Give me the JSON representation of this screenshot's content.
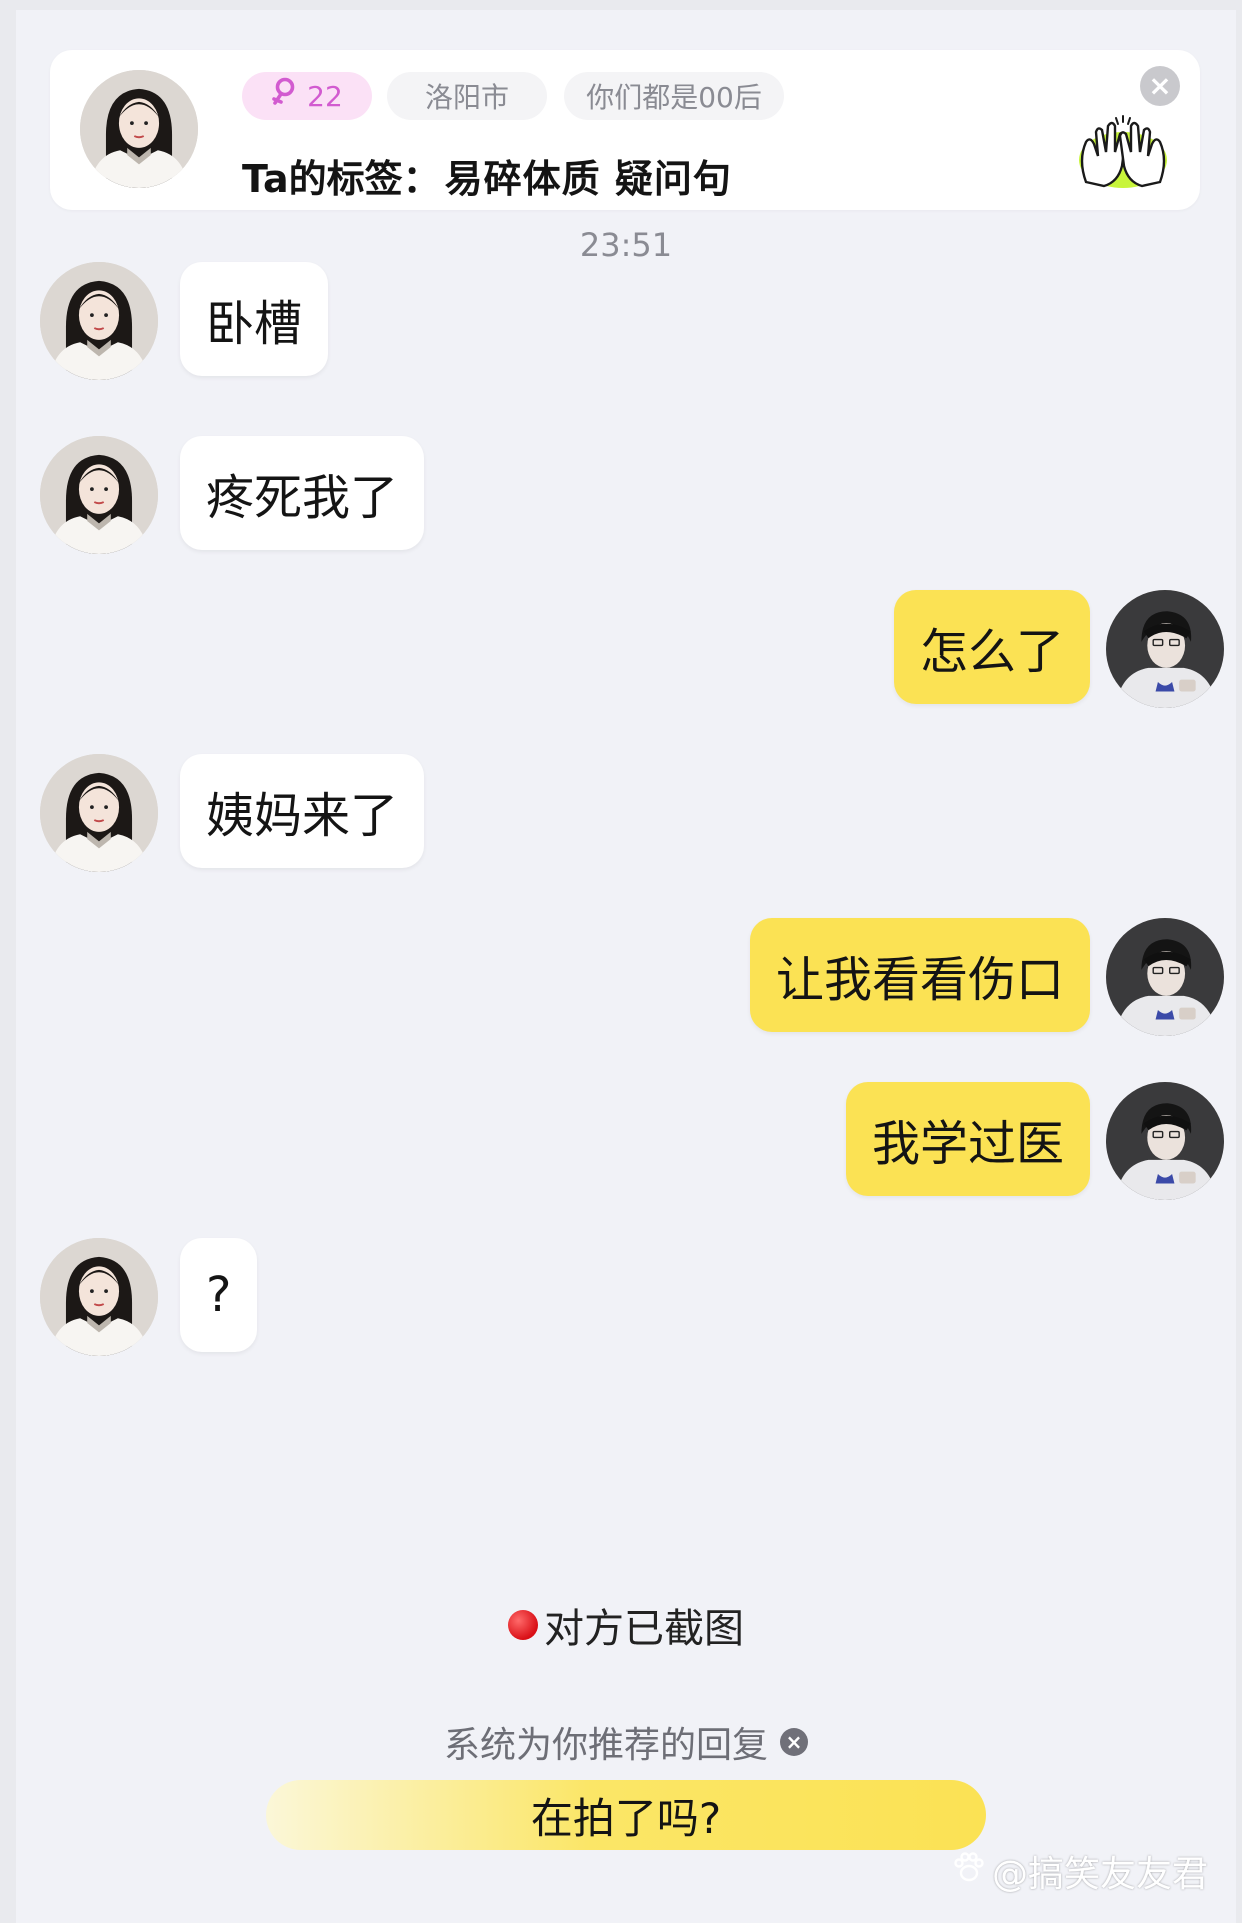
{
  "profile": {
    "age": "22",
    "city": "洛阳市",
    "common": "你们都是00后",
    "tags_label": "Ta的标签：",
    "tags": "易碎体质 疑问句"
  },
  "timestamp": "23:51",
  "messages": [
    {
      "side": "incoming",
      "text": "卧槽"
    },
    {
      "side": "incoming",
      "text": "疼死我了"
    },
    {
      "side": "outgoing",
      "text": "怎么了"
    },
    {
      "side": "incoming",
      "text": "姨妈来了"
    },
    {
      "side": "outgoing",
      "text": "让我看看伤口"
    },
    {
      "side": "outgoing",
      "text": "我学过医"
    },
    {
      "side": "incoming",
      "text": "?"
    }
  ],
  "screenshot_notice": "对方已截图",
  "suggestion": {
    "title": "系统为你推荐的回复",
    "reply": "在拍了吗?"
  },
  "watermark": "@搞笑友友君",
  "colors": {
    "outgoing_bubble": "#fbe254",
    "incoming_bubble": "#ffffff",
    "age_chip_bg": "#fbe1f6",
    "age_chip_text": "#d25bd0",
    "background": "#f1f2f7"
  },
  "icons": {
    "gender": "female-icon",
    "card_close": "close-icon",
    "high_five": "high-five-icon",
    "notice": "red-dot-icon",
    "suggest_close": "close-icon",
    "watermark": "paw-icon"
  }
}
